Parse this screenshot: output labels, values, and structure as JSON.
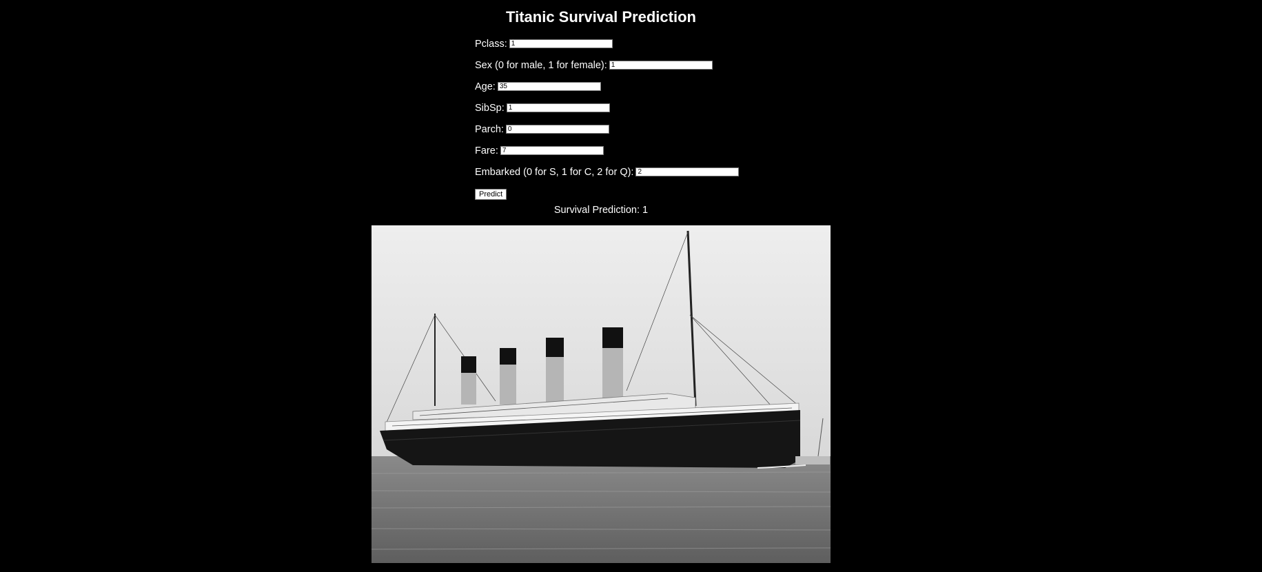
{
  "page": {
    "title": "Titanic Survival Prediction"
  },
  "form": {
    "fields": [
      {
        "label": "Pclass:",
        "value": "1"
      },
      {
        "label": "Sex (0 for male, 1 for female):",
        "value": "1"
      },
      {
        "label": "Age:",
        "value": "35"
      },
      {
        "label": "SibSp:",
        "value": "1"
      },
      {
        "label": "Parch:",
        "value": "0"
      },
      {
        "label": "Fare:",
        "value": "7"
      },
      {
        "label": "Embarked (0 for S, 1 for C, 2 for Q):",
        "value": "2"
      }
    ],
    "submit_label": "Predict"
  },
  "result": {
    "label": "Survival Prediction:",
    "value": "1"
  },
  "image": {
    "description_icon": "titanic-ship-photo"
  }
}
